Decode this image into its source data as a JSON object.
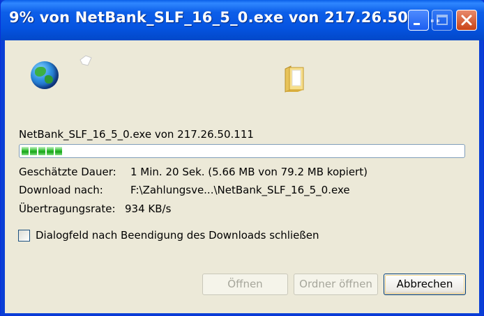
{
  "window": {
    "title": "9% von NetBank_SLF_16_5_0.exe von 217.26.50.1..."
  },
  "download": {
    "file_line": "NetBank_SLF_16_5_0.exe von 217.26.50.111",
    "progress_percent": 9,
    "estimated_label": "Geschätzte Dauer:",
    "estimated_value": "1 Min. 20 Sek. (5.66 MB von 79.2 MB kopiert)",
    "target_label": "Download nach:",
    "target_value": "F:\\Zahlungsve...\\NetBank_SLF_16_5_0.exe",
    "rate_label": "Übertragungsrate:",
    "rate_value": "934 KB/s"
  },
  "options": {
    "close_on_finish_label": "Dialogfeld nach Beendigung des Downloads schließen",
    "close_on_finish_checked": false
  },
  "buttons": {
    "open": "Öffnen",
    "open_folder": "Ordner öffnen",
    "cancel": "Abbrechen"
  },
  "icons": {
    "source": "globe-icon",
    "flying": "document-icon",
    "destination": "folder-icon"
  }
}
